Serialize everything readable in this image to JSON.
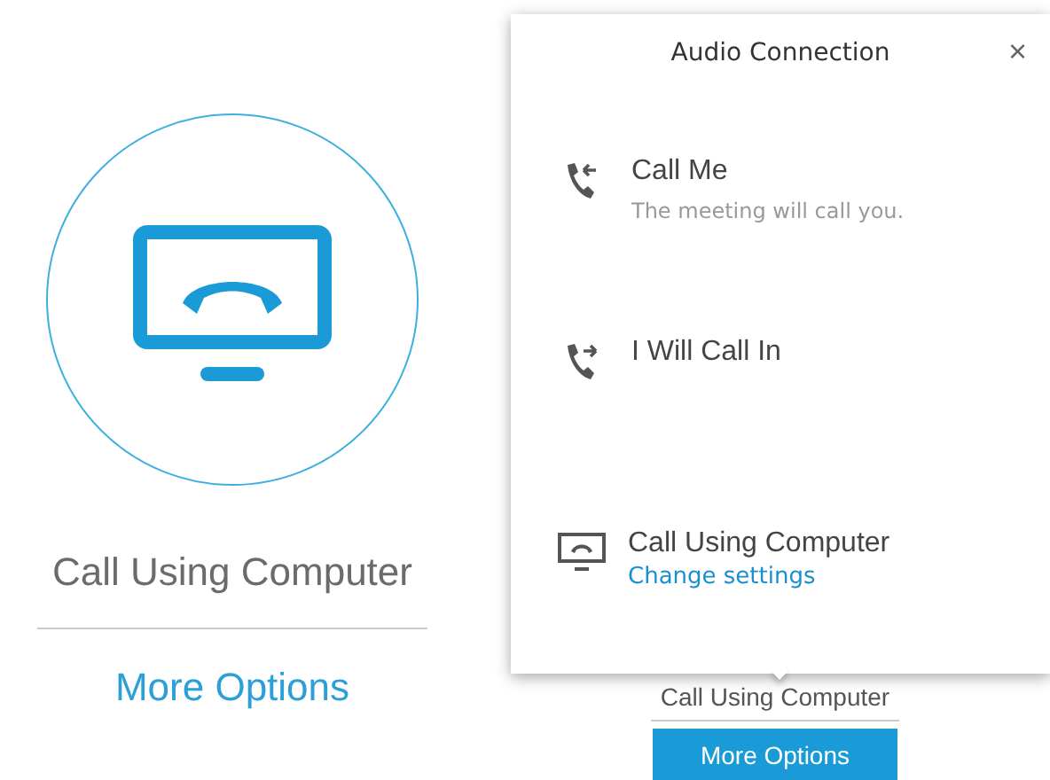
{
  "left_option": {
    "label": "Call Using Computer",
    "link": "More Options"
  },
  "right_option": {
    "label": "Call Using Computer",
    "button": "More Options"
  },
  "popup": {
    "title": "Audio Connection",
    "close": "×",
    "items": [
      {
        "kind": "call-me",
        "title": "Call Me",
        "subtitle": "The meeting will call you."
      },
      {
        "kind": "call-in",
        "title": "I Will Call In"
      },
      {
        "kind": "computer",
        "title": "Call Using Computer",
        "link": "Change settings"
      }
    ]
  }
}
